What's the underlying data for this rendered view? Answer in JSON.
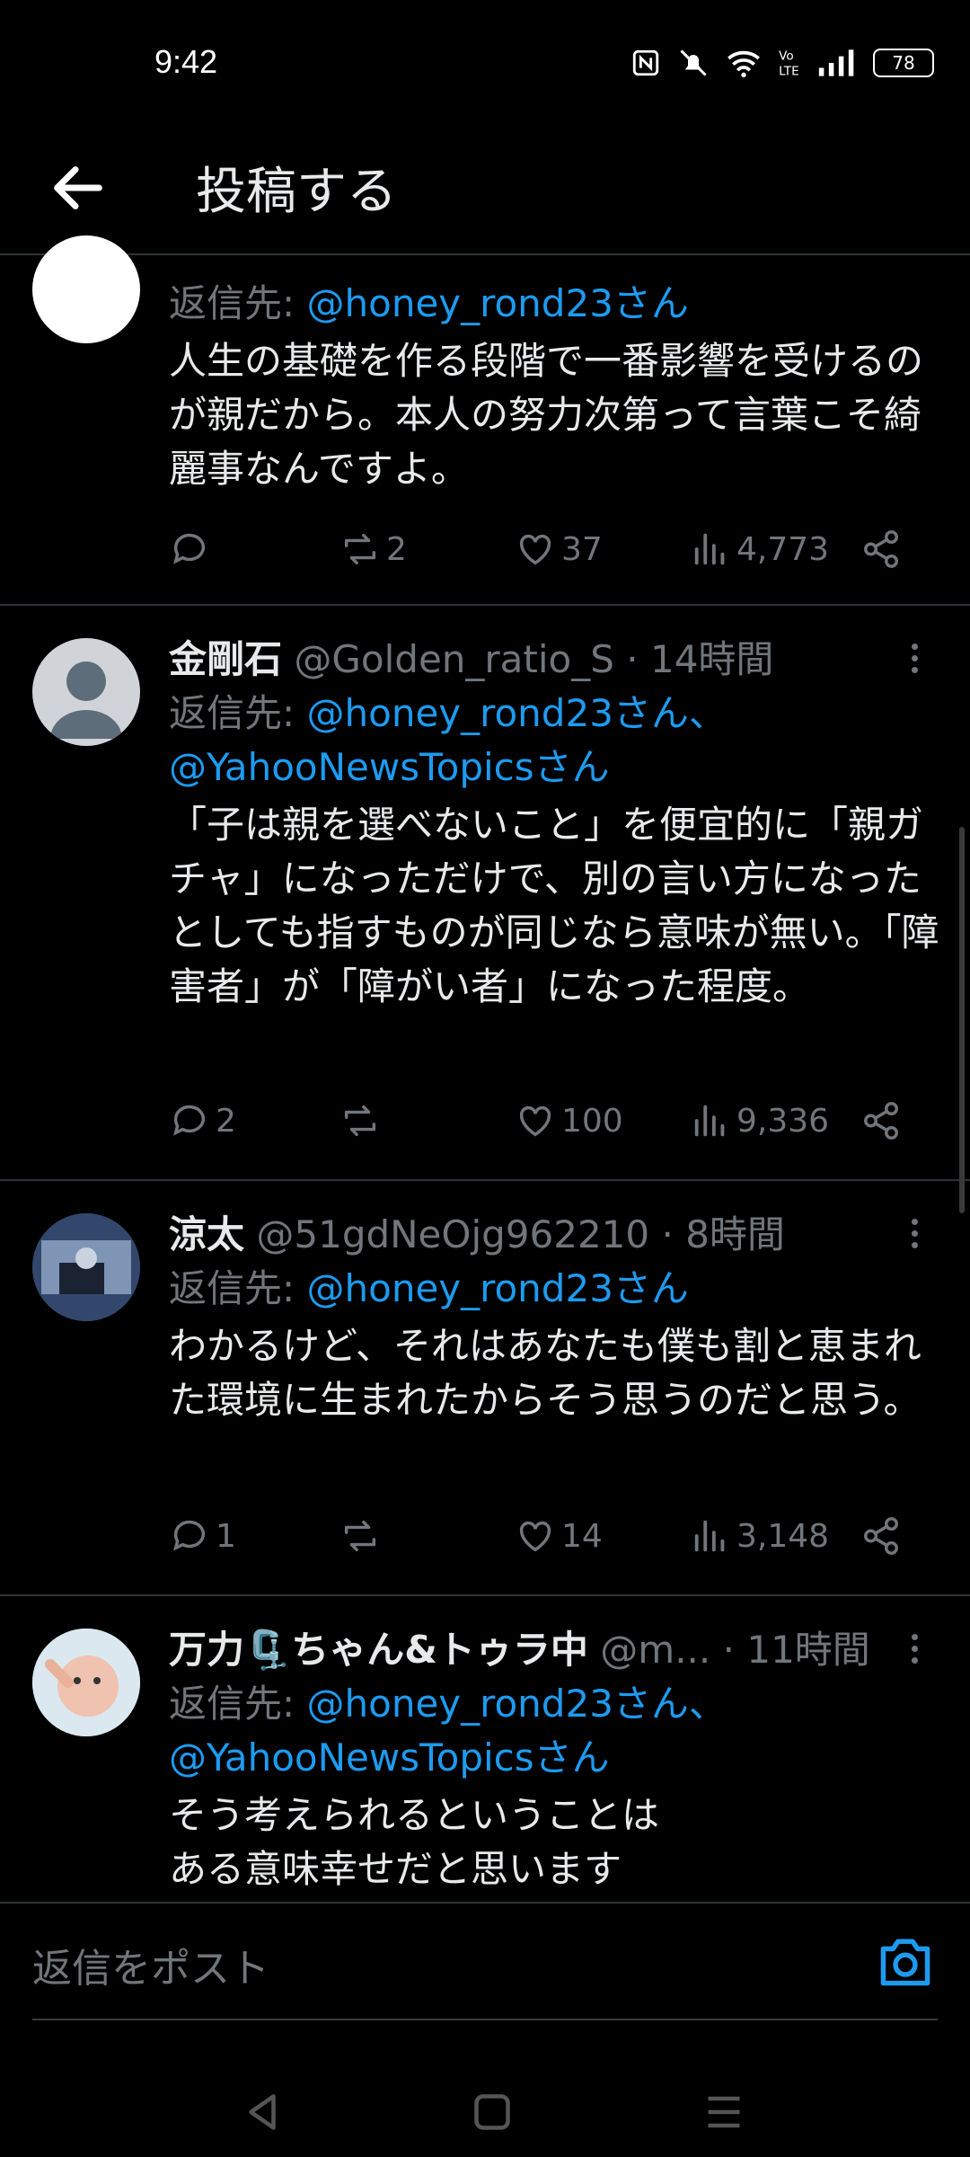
{
  "status": {
    "time": "9:42",
    "battery": "78"
  },
  "header": {
    "title": "投稿する"
  },
  "tweets": [
    {
      "reply_prefix": "返信先:",
      "reply_to": "@honey_rond23さん",
      "text": "人生の基礎を作る段階で一番影響を受けるのが親だから。本人の努力次第って言葉こそ綺麗事なんですよ。",
      "replies": "",
      "retweets": "2",
      "likes": "37",
      "views": "4,773"
    },
    {
      "name": "金剛石",
      "handle": "@Golden_ratio_S",
      "dot": "·",
      "ago": "14時間",
      "reply_prefix": "返信先:",
      "reply_to": "@honey_rond23さん、",
      "reply_to2": "@YahooNewsTopicsさん",
      "text": "「子は親を選べないこと」を便宜的に「親ガチャ」になっただけで、別の言い方になったとしても指すものが同じなら意味が無い。「障害者」が「障がい者」になった程度。",
      "replies": "2",
      "retweets": "",
      "likes": "100",
      "views": "9,336"
    },
    {
      "name": "涼太",
      "handle": "@51gdNeOjg962210",
      "dot": "·",
      "ago": "8時間",
      "reply_prefix": "返信先:",
      "reply_to": "@honey_rond23さん",
      "text": "わかるけど、それはあなたも僕も割と恵まれた環境に生まれたからそう思うのだと思う。",
      "replies": "1",
      "retweets": "",
      "likes": "14",
      "views": "3,148"
    },
    {
      "name": "万力🗜️ちゃん&トゥラ中",
      "handle": "@m...",
      "dot": "·",
      "ago": "11時間",
      "reply_prefix": "返信先:",
      "reply_to": "@honey_rond23さん、",
      "reply_to2": "@YahooNewsTopicsさん",
      "text_line1": "そう考えられるということは",
      "text_line2": "ある意味幸せだと思います"
    }
  ],
  "reply_bar": {
    "placeholder": "返信をポスト"
  },
  "icons": [
    "back-arrow-icon",
    "reply-icon",
    "retweet-icon",
    "like-icon",
    "views-icon",
    "share-icon",
    "more-icon",
    "camera-icon",
    "nfc-icon",
    "mute-icon",
    "wifi-icon",
    "volte-icon",
    "signal-icon",
    "nav-back-icon",
    "nav-home-icon",
    "nav-menu-icon"
  ],
  "colors": {
    "background": "#000000",
    "link": "#1d9bf0",
    "muted": "#71767b",
    "text": "#e7e9ea"
  }
}
